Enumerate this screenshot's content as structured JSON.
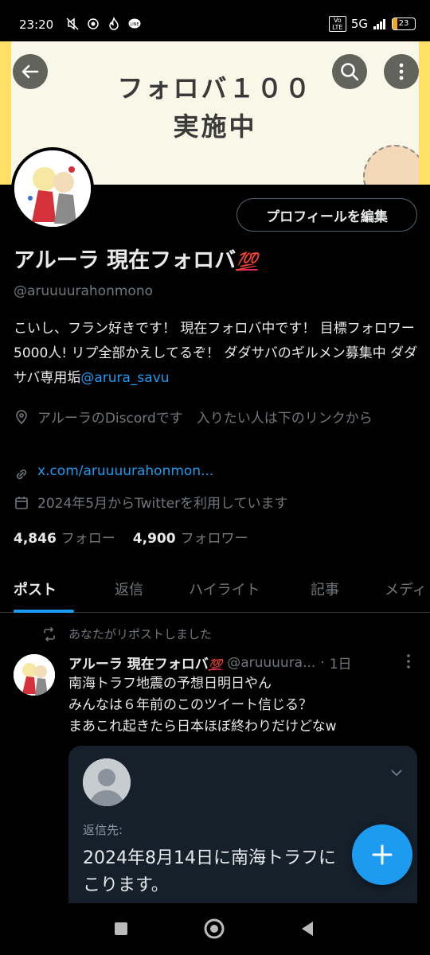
{
  "status_bar": {
    "time": "23:20",
    "network": "5G",
    "volte": "Vo LTE",
    "battery_level": "23",
    "battery_fraction": 0.23,
    "battery_color": "#f5a623"
  },
  "banner": {
    "title_line1": "フォロバ１００",
    "title_line2": "実施中",
    "background_color": "#f8f7e8",
    "edge_color": "#ffe066"
  },
  "header": {
    "back_icon": "arrow-left-icon",
    "search_icon": "search-icon",
    "more_icon": "more-vertical-icon"
  },
  "profile": {
    "edit_button_label": "プロフィールを編集",
    "display_name": "アルーラ 現在フォロバ",
    "name_emoji": "💯",
    "handle": "@aruuuurahonmono",
    "bio_text": "こいし、フラン好きです！ 現在フォロバ中です！ 目標フォロワー5000人! リプ全部かえしてるぞ！ ダダサバのギルメン募集中 ダダサバ専用垢",
    "bio_mention": "@arura_savu",
    "location": "アルーラのDiscordです　入りたい人は下のリンクから",
    "link": "x.com/aruuuurahonmon...",
    "joined": "2024年5月からTwitterを利用しています",
    "following_count": "4,846",
    "following_label": "フォロー",
    "followers_count": "4,900",
    "followers_label": "フォロワー"
  },
  "tabs": [
    {
      "label": "ポスト",
      "active": true
    },
    {
      "label": "返信",
      "active": false
    },
    {
      "label": "ハイライト",
      "active": false
    },
    {
      "label": "記事",
      "active": false
    },
    {
      "label": "メディ",
      "active": false
    }
  ],
  "timeline": {
    "repost_note": "あなたがリポストしました",
    "tweet": {
      "name": "アルーラ 現在フォロバ",
      "name_emoji": "💯",
      "handle": "@aruuuura...",
      "dot": "·",
      "time": "1日",
      "body_lines": [
        "南海トラフ地震の予想日明日やん",
        "みんなは６年前のこのツイート信じる？",
        "まあこれ起きたら日本ほぼ終わりだけどなw"
      ]
    },
    "quote": {
      "reply_to_label": "返信先:",
      "text_line1": "2024年8月14日に南海トラフに",
      "text_line2": "こります。",
      "background_color": "#15202b"
    }
  },
  "colors": {
    "accent": "#1d9bf0",
    "muted": "#71767b",
    "text": "#e7e9ea",
    "background": "#000000",
    "emoji_red": "#e0245e"
  },
  "fab": {
    "icon": "plus-icon"
  },
  "nav_bar": {
    "recents_icon": "square-recents-icon",
    "home_icon": "circle-home-icon",
    "back_icon": "triangle-back-icon"
  }
}
